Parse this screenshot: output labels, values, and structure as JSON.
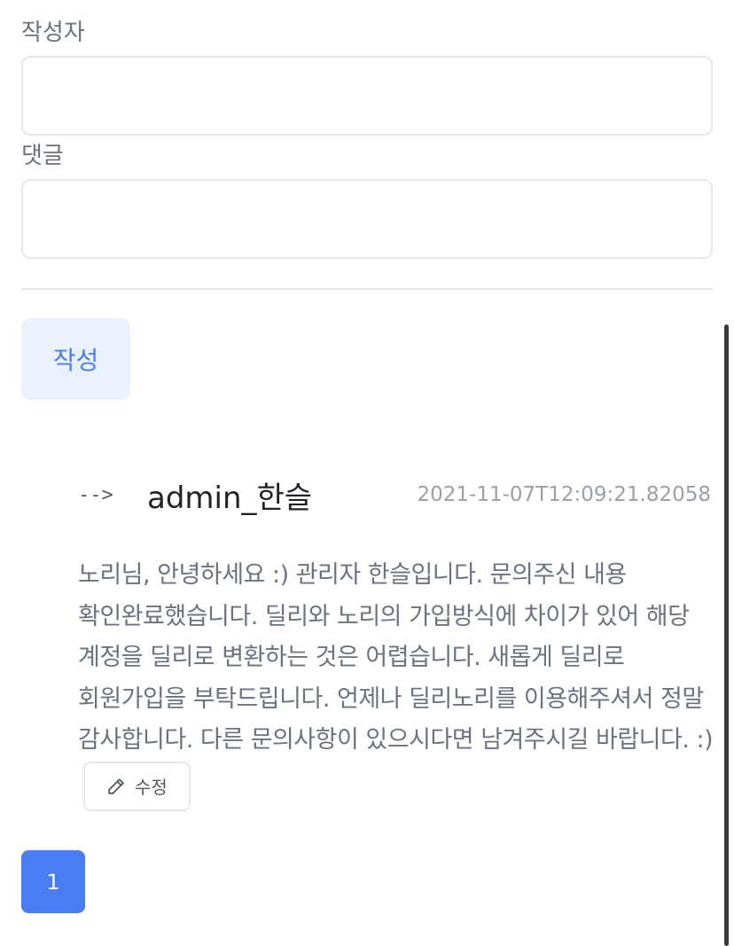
{
  "form": {
    "author_label": "작성자",
    "author_value": "",
    "comment_label": "댓글",
    "comment_value": "",
    "submit_label": "작성"
  },
  "comments": [
    {
      "reply_marker": "-->",
      "author": "admin_한슬",
      "timestamp": "2021-11-07T12:09:21.82058",
      "text": "노리님, 안녕하세요 :) 관리자 한슬입니다. 문의주신 내용 확인완료했습니다. 딜리와 노리의 가입방식에 차이가 있어 해당 계정을 딜리로 변환하는 것은 어렵습니다. 새롭게 딜리로 회원가입을 부탁드립니다. 언제나 딜리노리를 이용해주셔서 정말 감사합니다. 다른 문의사항이 있으시다면 남겨주시길 바랍니다. :)",
      "edit_label": "수정",
      "edit_icon": "pencil-icon"
    }
  ],
  "pagination": {
    "current_page": "1"
  },
  "colors": {
    "accent": "#4a7cf3",
    "submit_bg": "#eaf1fd",
    "submit_text": "#4a7fe8",
    "border": "#e5e7eb",
    "muted_text": "#6b7280",
    "timestamp_text": "#9aa0a8"
  }
}
